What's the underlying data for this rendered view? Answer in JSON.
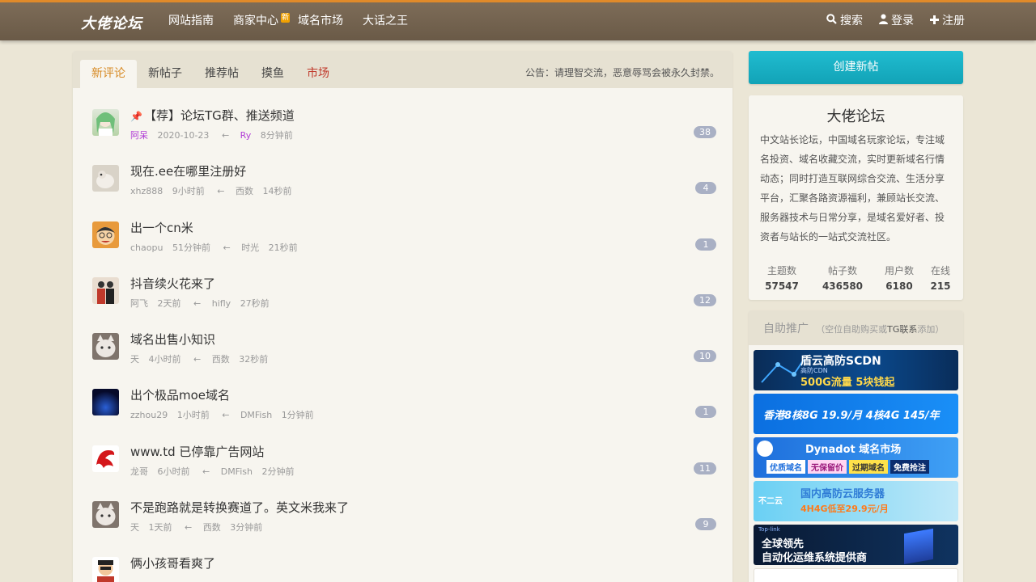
{
  "site": {
    "logo": "大佬论坛"
  },
  "nav": [
    {
      "label": "网站指南"
    },
    {
      "label": "商家中心",
      "badge": "新"
    },
    {
      "label": "域名市场"
    },
    {
      "label": "大话之王"
    }
  ],
  "user_nav": {
    "search": "搜索",
    "login": "登录",
    "register": "注册"
  },
  "tabs": [
    {
      "label": "新评论",
      "active": true
    },
    {
      "label": "新帖子"
    },
    {
      "label": "推荐帖"
    },
    {
      "label": "摸鱼"
    },
    {
      "label": "市场"
    }
  ],
  "notice": "公告：请理智交流，恶意辱骂会被永久封禁。",
  "topics": [
    {
      "title": "【荐】论坛TG群、推送频道",
      "pinned": true,
      "author": "阿呆",
      "time": "2020-10-23",
      "last_user": "Ry",
      "last_time": "8分钟前",
      "count": "38"
    },
    {
      "title": "现在.ee在哪里注册好",
      "author": "xhz888",
      "time": "9小时前",
      "last_user": "西数",
      "last_time": "14秒前",
      "count": "4"
    },
    {
      "title": "出一个cn米",
      "author": "chaopu",
      "time": "51分钟前",
      "last_user": "时光",
      "last_time": "21秒前",
      "count": "1"
    },
    {
      "title": "抖音续火花来了",
      "author": "阿飞",
      "time": "2天前",
      "last_user": "hifly",
      "last_time": "27秒前",
      "count": "12"
    },
    {
      "title": "域名出售小知识",
      "author": "天",
      "time": "4小时前",
      "last_user": "西数",
      "last_time": "32秒前",
      "count": "10"
    },
    {
      "title": "出个极品moe域名",
      "author": "zzhou29",
      "time": "1小时前",
      "last_user": "DMFish",
      "last_time": "1分钟前",
      "count": "1"
    },
    {
      "title": "www.td 已停靠广告网站",
      "author": "龙哥",
      "time": "6小时前",
      "last_user": "DMFish",
      "last_time": "2分钟前",
      "count": "11"
    },
    {
      "title": "不是跑路就是转换赛道了。英文米我来了",
      "author": "天",
      "time": "1天前",
      "last_user": "西数",
      "last_time": "3分钟前",
      "count": "9"
    },
    {
      "title": "俩小孩哥看爽了",
      "author": "",
      "time": "",
      "last_user": "",
      "last_time": "",
      "count": ""
    }
  ],
  "sidebar": {
    "create_button": "创建新帖",
    "forum_name": "大佬论坛",
    "forum_desc": "中文站长论坛，中国域名玩家论坛，专注域名投资、域名收藏交流，实时更新域名行情动态；同时打造互联网综合交流、生活分享平台，汇聚各路资源福利，兼顾站长交流、服务器技术与日常分享，是域名爱好者、投资者与站长的一站式交流社区。",
    "stats": [
      {
        "label": "主题数",
        "value": "57547"
      },
      {
        "label": "帖子数",
        "value": "436580"
      },
      {
        "label": "用户数",
        "value": "6180"
      },
      {
        "label": "在线",
        "value": "215"
      }
    ],
    "promo_title": "自助推广",
    "promo_sub_pre": "（空位自助购买或",
    "promo_sub_link": "TG联系",
    "promo_sub_post": "添加）",
    "banners": [
      {
        "line1": "盾云高防SCDN",
        "line2": "高防CDN",
        "line3": "500G流量 5块钱起"
      },
      {
        "line1": "香港8核8G 19.9/月 4核4G 145/年"
      },
      {
        "line1": "Dynadot 域名市场",
        "tags": [
          "优质域名",
          "无保留价",
          "过期域名",
          "免费抢注"
        ]
      },
      {
        "line1": "国内高防云服务器",
        "line2": "4H4G低至29.9元/月",
        "logo": "不二云"
      },
      {
        "line1": "全球领先",
        "line2": "自动化运维系统提供商",
        "logo": "Top-link"
      }
    ]
  }
}
